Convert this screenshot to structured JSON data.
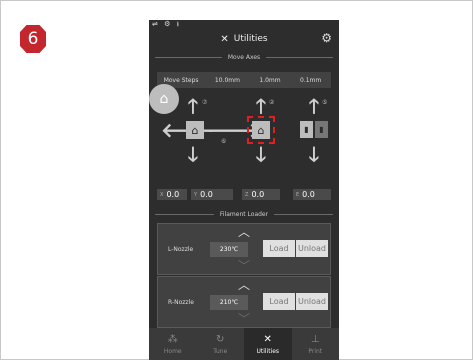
{
  "step_badge": "6",
  "status_bar": {
    "icons": [
      "wifi-icon",
      "usb-icon",
      "download-icon"
    ],
    "text": "⇌ ⚙ ⭳"
  },
  "header": {
    "title": "Utilities",
    "title_icon": "tools-icon",
    "settings_icon": "gear-icon"
  },
  "move_axes": {
    "section_title": "Move Axes",
    "steps_label": "Move Steps",
    "steps": [
      "10.0mm",
      "1.0mm",
      "0.1mm"
    ],
    "home_all_icon": "home-all-icon",
    "xy_markers": {
      "y": "⑦",
      "x": "⑥"
    },
    "z_marker": "②",
    "e_marker": "⑤",
    "coords": {
      "x": {
        "axis": "X",
        "value": "0.0"
      },
      "y": {
        "axis": "Y",
        "value": "0.0"
      },
      "z": {
        "axis": "Z",
        "value": "0.0"
      },
      "e": {
        "axis": "E",
        "value": "0.0"
      }
    }
  },
  "filament_loader": {
    "section_title": "Filament Loader",
    "nozzles": [
      {
        "label": "L-Nozzle",
        "temp": "230℃",
        "load": "Load",
        "unload": "Unload"
      },
      {
        "label": "R-Nozzle",
        "temp": "210℃",
        "load": "Load",
        "unload": "Unload"
      }
    ]
  },
  "tabs": [
    {
      "label": "Home",
      "icon": "home-tab-icon",
      "active": false
    },
    {
      "label": "Tune",
      "icon": "refresh-icon",
      "active": false
    },
    {
      "label": "Utilities",
      "icon": "tools-icon",
      "active": true
    },
    {
      "label": "Print",
      "icon": "print-icon",
      "active": false
    }
  ],
  "colors": {
    "badge": "#c4262e",
    "screen_bg": "#2d2d2d",
    "highlight_dashed": "#e02020"
  }
}
